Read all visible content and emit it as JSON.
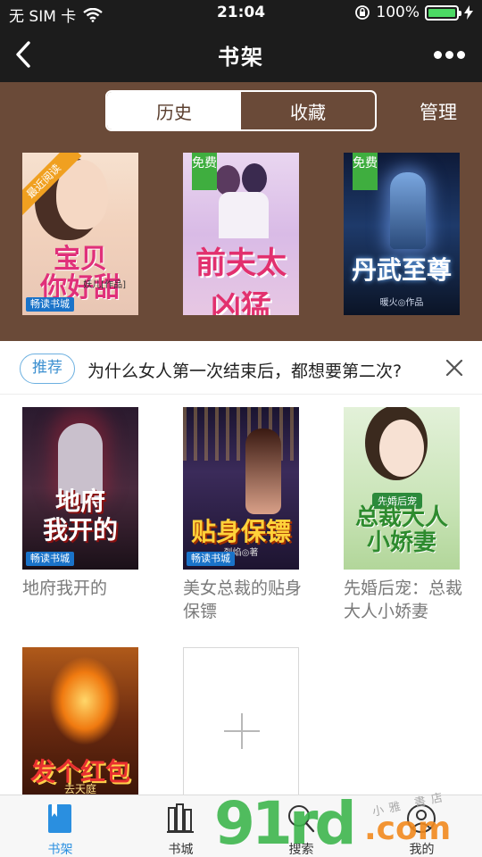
{
  "status_bar": {
    "carrier": "无 SIM 卡",
    "time": "21:04",
    "battery": "100%",
    "battery_level": 1.0
  },
  "nav": {
    "title": "书架",
    "back_icon": "chevron-left-icon",
    "more_icon": "more-dots-icon"
  },
  "shelf": {
    "tabs": [
      {
        "label": "历史",
        "active": true
      },
      {
        "label": "收藏",
        "active": false
      }
    ],
    "manage_label": "管理",
    "covers": [
      {
        "ribbon": "最近阅读",
        "title_line1": "宝贝",
        "title_line2": "你好甜",
        "author": "妖儿[作品]",
        "brand": "畅读书城"
      },
      {
        "badge": "免费",
        "title": "前夫太凶猛"
      },
      {
        "badge": "免费",
        "title": "丹武至尊",
        "author": "暖火◎作品"
      }
    ]
  },
  "recommend": {
    "tag": "推荐",
    "text": "为什么女人第一次结束后，都想要第二次?"
  },
  "books": [
    {
      "name": "地府我开的",
      "cover_title_line1": "地府",
      "cover_title_line2": "我开的",
      "brand": "畅读书城"
    },
    {
      "name": "美女总裁的贴身保镖",
      "cover_title": "贴身保镖",
      "brand": "畅读书城",
      "author": "烈焰◎著"
    },
    {
      "name": "先婚后宠：总裁大人小娇妻",
      "cover_label": "先婚后宠",
      "cover_title_line1": "总裁大人",
      "cover_title_line2": "小娇妻"
    },
    {
      "cover_title": "发个红包",
      "cover_sub": "去天庭"
    }
  ],
  "tab_bar": {
    "items": [
      {
        "label": "书架",
        "icon": "bookshelf-icon",
        "active": true
      },
      {
        "label": "书城",
        "icon": "bookstore-icon",
        "active": false
      },
      {
        "label": "搜索",
        "icon": "search-icon",
        "active": false
      },
      {
        "label": "我的",
        "icon": "user-icon",
        "active": false
      }
    ]
  },
  "watermark": {
    "digits": "91rd",
    "domain": ".com",
    "small": "小雅 書店"
  },
  "colors": {
    "bar": "#1c1c1c",
    "shelf_bg": "#6a4a38",
    "accent_blue": "#2a8fe0",
    "badge_green": "#3fae3f"
  }
}
